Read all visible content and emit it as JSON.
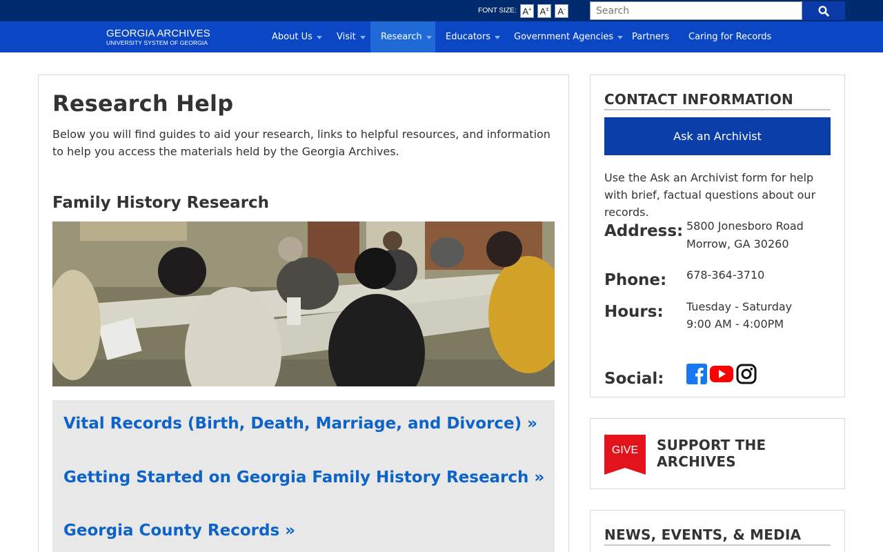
{
  "utility": {
    "font_size_label": "FONT SIZE:",
    "font_buttons": [
      {
        "glyph": "A",
        "sup": "+"
      },
      {
        "glyph": "A",
        "sup": "±"
      },
      {
        "glyph": "A",
        "sup": "-"
      }
    ],
    "search_placeholder": "Search",
    "search_value": ""
  },
  "logo": {
    "name": "GEORGIA ARCHIVES",
    "subtitle": "UNIVERSITY SYSTEM OF GEORGIA"
  },
  "nav": {
    "items": [
      {
        "label": "About Us"
      },
      {
        "label": "Visit"
      },
      {
        "label": "Research"
      },
      {
        "label": "Educators"
      },
      {
        "label": "Government Agencies"
      },
      {
        "label": "Partners"
      },
      {
        "label": "Caring for Records"
      }
    ],
    "active": "Research"
  },
  "main": {
    "title": "Research Help",
    "intro": "Below you will find guides to aid your research, links to helpful resources, and information to help you access the materials held by the Georgia Archives.",
    "section_title": "Family History Research",
    "links": [
      {
        "label": "Vital Records (Birth, Death, Marriage, and Divorce) »"
      },
      {
        "label": "Getting Started on Georgia Family History Research »"
      },
      {
        "label": "Georgia County Records »"
      }
    ]
  },
  "contact": {
    "heading": "CONTACT INFORMATION",
    "ask_button": "Ask an Archivist",
    "description": "Use the Ask an Archivist form for help with brief, factual questions about our records.",
    "address_label": "Address:",
    "address_line1": "5800 Jonesboro Road",
    "address_line2": "Morrow, GA 30260",
    "phone_label": "Phone:",
    "phone": "678-364-3710",
    "hours_label": "Hours:",
    "hours_days": "Tuesday - Saturday",
    "hours_time": "9:00 AM - 4:00PM",
    "social_label": "Social:",
    "social_icons": [
      "facebook-icon",
      "youtube-icon",
      "instagram-icon"
    ]
  },
  "support": {
    "badge": "GIVE",
    "heading": "SUPPORT THE ARCHIVES"
  },
  "news": {
    "heading": "NEWS, EVENTS, & MEDIA"
  },
  "colors": {
    "utility_bar": "#002a6e",
    "nav_bar": "#0b46c4",
    "nav_active": "#1f6ad6",
    "link": "#0d63c7",
    "button": "#0b3ea8",
    "give_red": "#e3131b",
    "facebook": "#1877f2",
    "youtube": "#ff0000"
  }
}
